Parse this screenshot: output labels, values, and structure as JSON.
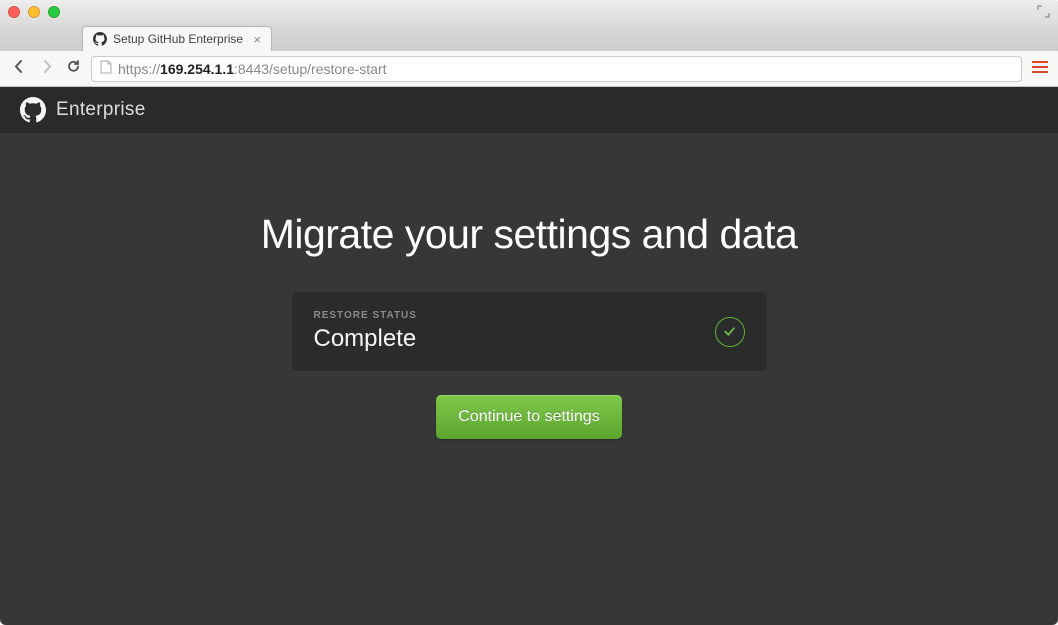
{
  "browser": {
    "tab_title": "Setup GitHub Enterprise",
    "url_proto": "https://",
    "url_host": "169.254.1.1",
    "url_port_path": ":8443/setup/restore-start"
  },
  "header": {
    "brand": "Enterprise"
  },
  "main": {
    "title": "Migrate your settings and data",
    "status_label": "RESTORE STATUS",
    "status_value": "Complete",
    "continue_label": "Continue to settings"
  }
}
